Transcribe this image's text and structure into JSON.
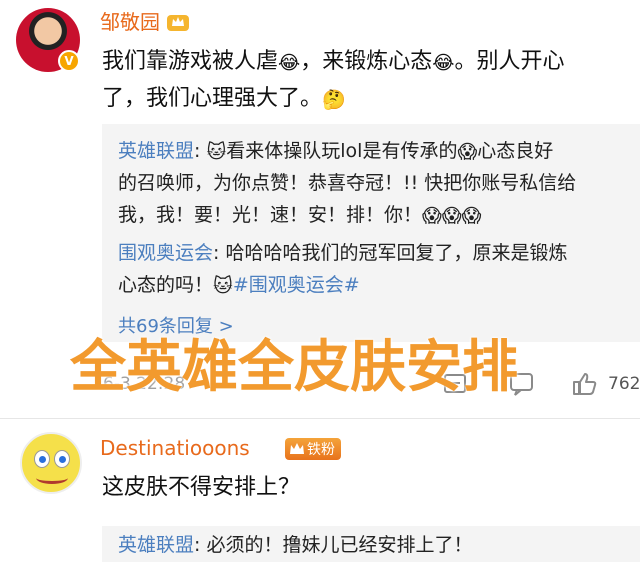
{
  "comment1": {
    "username": "邹敬园",
    "verified_badge": "V",
    "text_line1": "我们靠游戏被人虐",
    "emoji1": "😂",
    "text_mid": "，来锻炼心态",
    "emoji2": "😂",
    "text_end": "。别人开心",
    "text_line2": "了，我们心理强大了。",
    "emoji3": "🤔",
    "timestamp": "6-3 22:28",
    "like_count": "762"
  },
  "replies": {
    "reply1_name": "英雄联盟",
    "reply1_emoji1": "🐱",
    "reply1_text_a": "看来体操队玩lol是有传承的",
    "reply1_emoji2": "😱",
    "reply1_text_b": "心态良好",
    "reply1_line2": "的召唤师，为你点赞！恭喜夺冠！!! 快把你账号私信给",
    "reply1_line3": "我，我！要！光！速！安！排！你！",
    "reply1_emoji3": "😱😱😱",
    "reply2_name": "围观奥运会",
    "reply2_text_a": "哈哈哈哈我们的冠军回复了，原来是锻炼",
    "reply2_line2": "心态的吗！",
    "reply2_emoji": "🐱",
    "reply2_hashtag": "#围观奥运会#",
    "more_replies": "共69条回复 >"
  },
  "overlay": {
    "text": "全英雄全皮肤安排"
  },
  "comment2": {
    "username": "Destinatiooons",
    "fan_badge": "铁粉",
    "text": "这皮肤不得安排上？",
    "reply_name": "英雄联盟",
    "reply_text": ": 必须的！撸妹儿已经安排上了！"
  }
}
